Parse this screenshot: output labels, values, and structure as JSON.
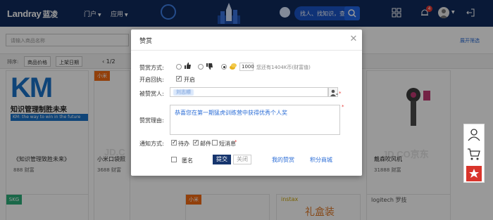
{
  "header": {
    "logo": "Landray",
    "logo_cn": "蓝凌",
    "nav": [
      "门户",
      "应用"
    ],
    "search_placeholder": "找人、找知识，查会议",
    "notification_count": "4"
  },
  "page": {
    "product_search_placeholder": "请输入商品名称",
    "top_right_link": "展开筛选",
    "sort_label": "排序:",
    "sort_options": [
      "商品价格",
      "上架日期"
    ],
    "pager": "1/2",
    "products": [
      {
        "title": "《知识管理致胜未来》",
        "price": "888 财富"
      },
      {
        "title": "小米口袋照",
        "price": "3688 财富"
      },
      {
        "title": "戴森吹风机",
        "price": "31888 财富"
      }
    ],
    "km_cover": {
      "big": "KM",
      "line1": "知识管理制胜未来",
      "line2": "KM: the way to win in the future"
    },
    "brand_tags": [
      "小米",
      "小米"
    ],
    "watermarks": [
      "JD.C",
      "JD.CO京东"
    ],
    "lower_brands": [
      "SKG",
      "instax",
      "logitech 罗技",
      "礼盒装"
    ]
  },
  "modal": {
    "title": "赞赏",
    "type_label": "赞赏方式:",
    "amount": "1000",
    "balance_hint": "您还有1404K币(财富值)",
    "reply_label": "开启回执:",
    "reply_option": "开启",
    "recipient_label": "被赞赏人:",
    "recipient_value": "刘志顺",
    "reason_label": "赞赏理由:",
    "reason_text": "恭喜您在第一期猛虎训练营中获得优秀个人奖",
    "notify_label": "通知方式:",
    "notify_options": [
      "待办",
      "邮件",
      "短消息"
    ],
    "anonymous_label": "匿名",
    "submit_label": "提交",
    "close_label": "关闭",
    "my_rewards_link": "我的赞赏",
    "points_mall_link": "积分商城"
  },
  "colors": {
    "nav_bg": "#0f2a5c",
    "primary": "#16356e",
    "link": "#2a6cd6",
    "required": "#e53935"
  }
}
